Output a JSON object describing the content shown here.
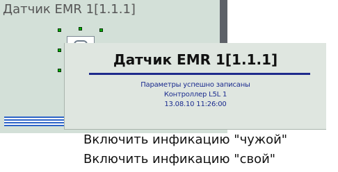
{
  "canvas": {
    "title": "Датчик EMR 1[1.1.1]"
  },
  "tooltip": {
    "title": "Датчик EMR 1[1.1.1]",
    "lines": [
      "Параметры успешно записаны",
      "Контроллер L5L 1",
      "13.08.10 11:26:00"
    ]
  },
  "menu": {
    "items": [
      {
        "label": "Включить инфикацию \"чужой\""
      },
      {
        "label": "Включить инфикацию \"свой\""
      }
    ]
  },
  "colors": {
    "canvas_bg": "#d3e0d8",
    "tooltip_bg": "#dfe6e0",
    "accent_blue": "#1e2a8c",
    "handle_green": "#00b000"
  }
}
